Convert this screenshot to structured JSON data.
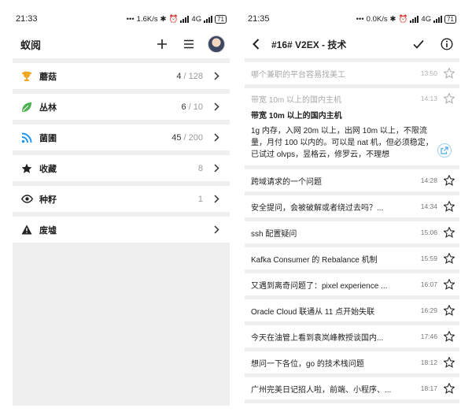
{
  "left": {
    "status": {
      "time": "21:33",
      "net_speed": "1.6K/s",
      "network": "4G",
      "battery": "71"
    },
    "app_title": "蚁阅",
    "nodes": [
      {
        "name": "蘑菇",
        "icon": "trophy-icon",
        "color": "#f5a623",
        "count": "4",
        "total": "/ 128"
      },
      {
        "name": "丛林",
        "icon": "leaf-icon",
        "color": "#4caf50",
        "count": "6",
        "total": "/ 10"
      },
      {
        "name": "菌圃",
        "icon": "rss-icon",
        "color": "#2196f3",
        "count": "45",
        "total": "/ 200"
      },
      {
        "name": "收藏",
        "icon": "star-icon",
        "color": "#333333",
        "count": "8",
        "total": ""
      },
      {
        "name": "种籽",
        "icon": "eye-icon",
        "color": "#333333",
        "count": "1",
        "total": ""
      },
      {
        "name": "废墟",
        "icon": "warning-icon",
        "color": "#333333",
        "count": "",
        "total": ""
      }
    ]
  },
  "right": {
    "status": {
      "time": "21:35",
      "net_speed": "0.0K/s",
      "network": "4G",
      "battery": "71"
    },
    "title": "#16# V2EX - 技术",
    "read_topic": {
      "title": "哪个兼职的平台容易找美工",
      "time": "13:50"
    },
    "expanded": {
      "title": "带宽 10m 以上的国内主机",
      "time": "14:13",
      "heading": "带宽 10m 以上的国内主机",
      "body": "1g 内存，入网 20m 以上，出网 10m 以上，不限流量，月付 100 以内的。可以是 nat 机，但必须稳定，已试过 olvps，昱格云，修罗云，不理想"
    },
    "topics": [
      {
        "title": "跨域请求的一个问题",
        "time": "14:28"
      },
      {
        "title": "安全提问，会被破解或者绕过去吗？...",
        "time": "14:34"
      },
      {
        "title": "ssh 配置疑问",
        "time": "15:06"
      },
      {
        "title": "Kafka Consumer 的 Rebalance 机制",
        "time": "15:59"
      },
      {
        "title": "又遇到离奇问题了：pixel experience ...",
        "time": "16:07"
      },
      {
        "title": "Oracle Cloud 联通从 11 点开始失联",
        "time": "16:29"
      },
      {
        "title": "今天在油管上看到袁岚峰教授谈国内...",
        "time": "17:46"
      },
      {
        "title": "想问一下各位，go 的技术栈问题",
        "time": "18:12"
      },
      {
        "title": "广州完美日记招人啦，前端、小程序、...",
        "time": "18:17"
      }
    ]
  }
}
